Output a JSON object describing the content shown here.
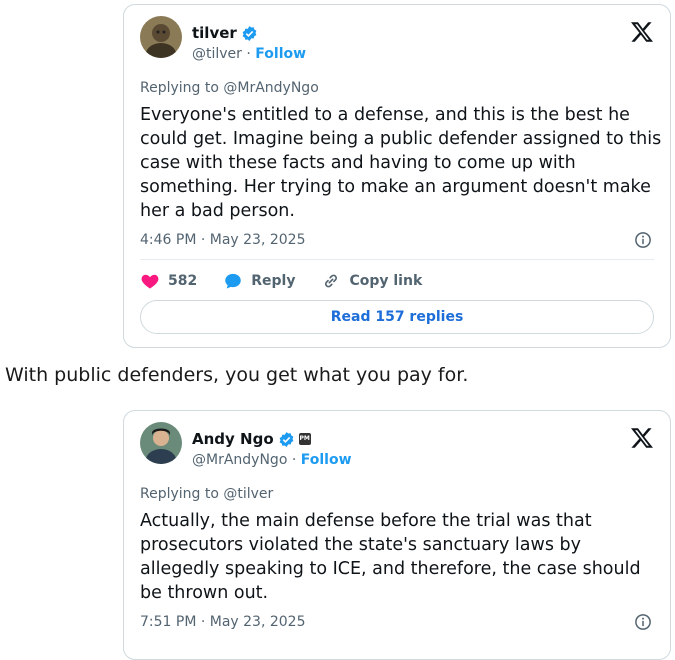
{
  "tweet1": {
    "display_name": "tilver",
    "handle": "@tilver",
    "separator": " · ",
    "follow_label": "Follow",
    "replying_to": "Replying to @MrAndyNgo",
    "text": "Everyone's entitled to a defense, and this is the best he could get. Imagine being a public defender assigned to this case with these facts and having to come up with something. Her trying to make an argument doesn't make her a bad person.",
    "timestamp": "4:46 PM · May 23, 2025",
    "likes": "582",
    "reply_label": "Reply",
    "copy_link_label": "Copy link",
    "read_replies_label": "Read 157 replies",
    "icons": [
      "verified-badge-icon",
      "x-logo-icon",
      "info-icon",
      "heart-icon",
      "reply-bubble-icon",
      "link-icon"
    ]
  },
  "between_text": "With public defenders, you get what you pay for.",
  "tweet2": {
    "display_name": "Andy Ngo",
    "handle": "@MrAndyNgo",
    "separator": " · ",
    "follow_label": "Follow",
    "affiliate_badge": "PM",
    "replying_to": "Replying to @tilver",
    "text": "Actually, the main defense before the trial was that prosecutors violated the state's sanctuary laws by allegedly speaking to ICE, and therefore, the case should be thrown out.",
    "timestamp": "7:51 PM · May 23, 2025",
    "icons": [
      "verified-badge-icon",
      "affiliate-badge-icon",
      "x-logo-icon",
      "info-icon"
    ]
  },
  "colors": {
    "accent": "#1d9bf0",
    "heart": "#f91880",
    "muted": "#536471",
    "border": "#cfd9de"
  }
}
